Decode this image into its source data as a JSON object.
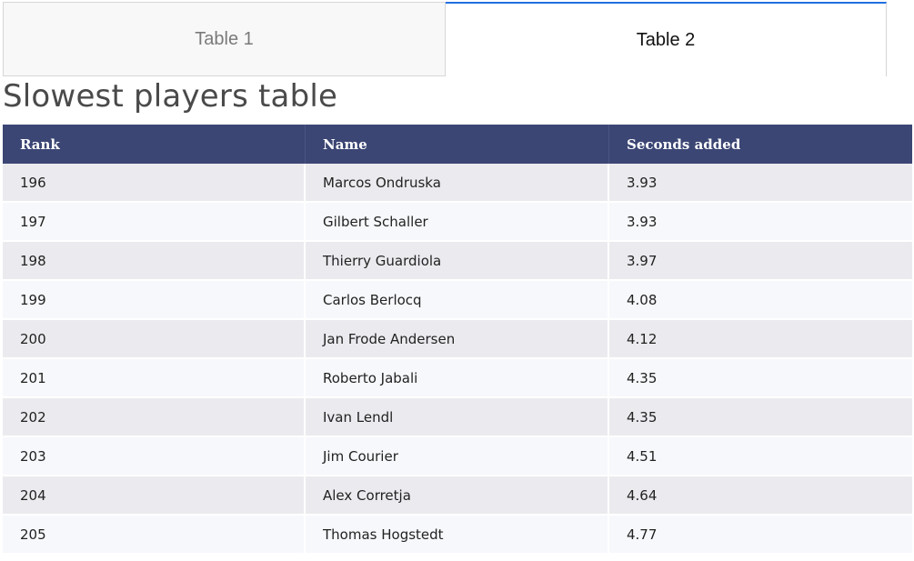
{
  "tabs": [
    {
      "label": "Table 1",
      "active": false
    },
    {
      "label": "Table 2",
      "active": true
    }
  ],
  "page_title": "Slowest players table",
  "table": {
    "columns": [
      "Rank",
      "Name",
      "Seconds added"
    ],
    "rows": [
      [
        "196",
        "Marcos Ondruska",
        "3.93"
      ],
      [
        "197",
        "Gilbert Schaller",
        "3.93"
      ],
      [
        "198",
        "Thierry Guardiola",
        "3.97"
      ],
      [
        "199",
        "Carlos Berlocq",
        "4.08"
      ],
      [
        "200",
        "Jan Frode Andersen",
        "4.12"
      ],
      [
        "201",
        "Roberto Jabali",
        "4.35"
      ],
      [
        "202",
        "Ivan Lendl",
        "4.35"
      ],
      [
        "203",
        "Jim Courier",
        "4.51"
      ],
      [
        "204",
        "Alex Corretja",
        "4.64"
      ],
      [
        "205",
        "Thomas Hogstedt",
        "4.77"
      ]
    ]
  },
  "colors": {
    "header_bg": "#3b4674",
    "active_tab_accent": "#1f6fe0",
    "row_odd": "#ebebef",
    "row_even": "#f7f8fb"
  }
}
